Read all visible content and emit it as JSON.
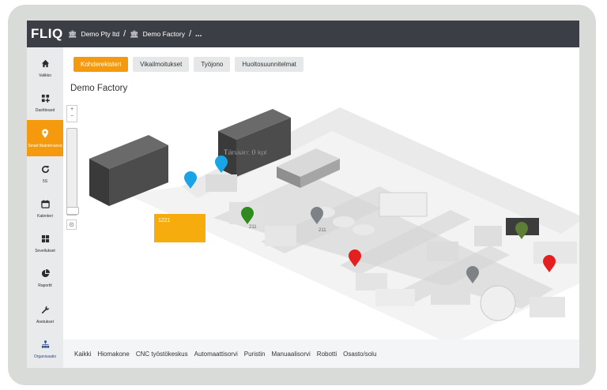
{
  "app": {
    "logo": "FLIQ"
  },
  "breadcrumb": {
    "org": "Demo Pty ltd",
    "site": "Demo Factory",
    "more": "..."
  },
  "sidebar": {
    "items": [
      {
        "label": "Valikko",
        "icon": "home-icon"
      },
      {
        "label": "Dashboard",
        "icon": "dashboard-icon"
      },
      {
        "label": "Smart Maintenance",
        "icon": "map-pin-icon"
      },
      {
        "label": "5S",
        "icon": "refresh-icon"
      },
      {
        "label": "Kalenteri",
        "icon": "calendar-icon"
      },
      {
        "label": "Sovellukset",
        "icon": "apps-icon"
      },
      {
        "label": "Raportit",
        "icon": "pie-chart-icon"
      },
      {
        "label": "Asetukset",
        "icon": "wrench-icon"
      },
      {
        "label": "Organisaatio",
        "icon": "org-icon"
      }
    ]
  },
  "tabs": [
    {
      "label": "Kohderekisteri",
      "active": true
    },
    {
      "label": "Vikailmoitukset",
      "active": false
    },
    {
      "label": "Työjono",
      "active": false
    },
    {
      "label": "Huoltosuunnitelmat",
      "active": false
    }
  ],
  "page": {
    "title": "Demo Factory"
  },
  "zoom": {
    "in": "+",
    "out": "−",
    "level_fraction": 0.05
  },
  "map": {
    "highlight_label": "1221",
    "tooltip": "Tänään: 0 kpl",
    "marker_labels": [
      "211",
      "211"
    ],
    "marker_colors": {
      "blue": "#1aa4e8",
      "green": "#2f8a1f",
      "olive": "#5e7d35",
      "red": "#e51f1f",
      "grey": "#7d8287"
    }
  },
  "filters": [
    "Kaikki",
    "Hiomakone",
    "CNC työstökeskus",
    "Automaattisorvi",
    "Puristin",
    "Manuaalisorvi",
    "Robotti",
    "Osasto/solu"
  ],
  "colors": {
    "accent": "#f5990f",
    "topbar": "#3b3f45",
    "sidebar": "#e9eaec"
  }
}
